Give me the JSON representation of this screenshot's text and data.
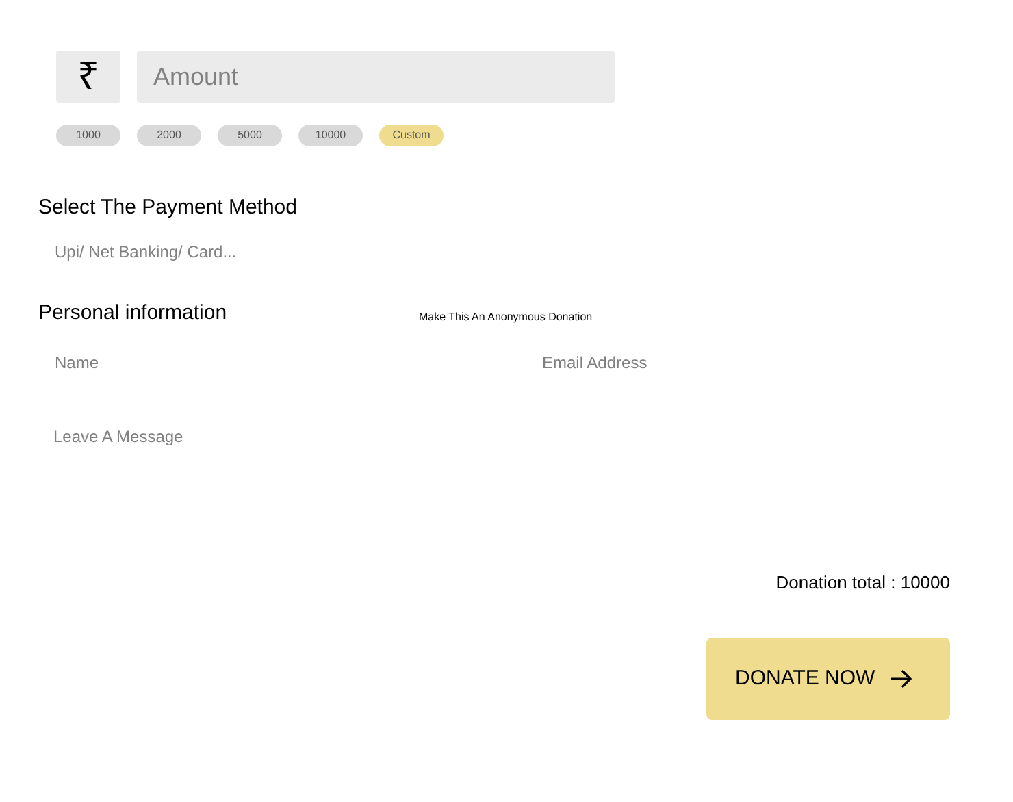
{
  "amount": {
    "currency_symbol": "₹",
    "placeholder": "Amount"
  },
  "presets": [
    {
      "label": "1000",
      "selected": false
    },
    {
      "label": "2000",
      "selected": false
    },
    {
      "label": "5000",
      "selected": false
    },
    {
      "label": "10000",
      "selected": false
    },
    {
      "label": "Custom",
      "selected": true
    }
  ],
  "payment": {
    "heading": "Select The Payment Method",
    "placeholder": "Upi/ Net Banking/ Card..."
  },
  "personal": {
    "heading": "Personal information",
    "anonymous_label": "Make This An Anonymous Donation",
    "name_placeholder": "Name",
    "email_placeholder": "Email Address",
    "message_placeholder": "Leave A Message"
  },
  "total": "Donation total : 10000",
  "donate_button": "DONATE NOW"
}
